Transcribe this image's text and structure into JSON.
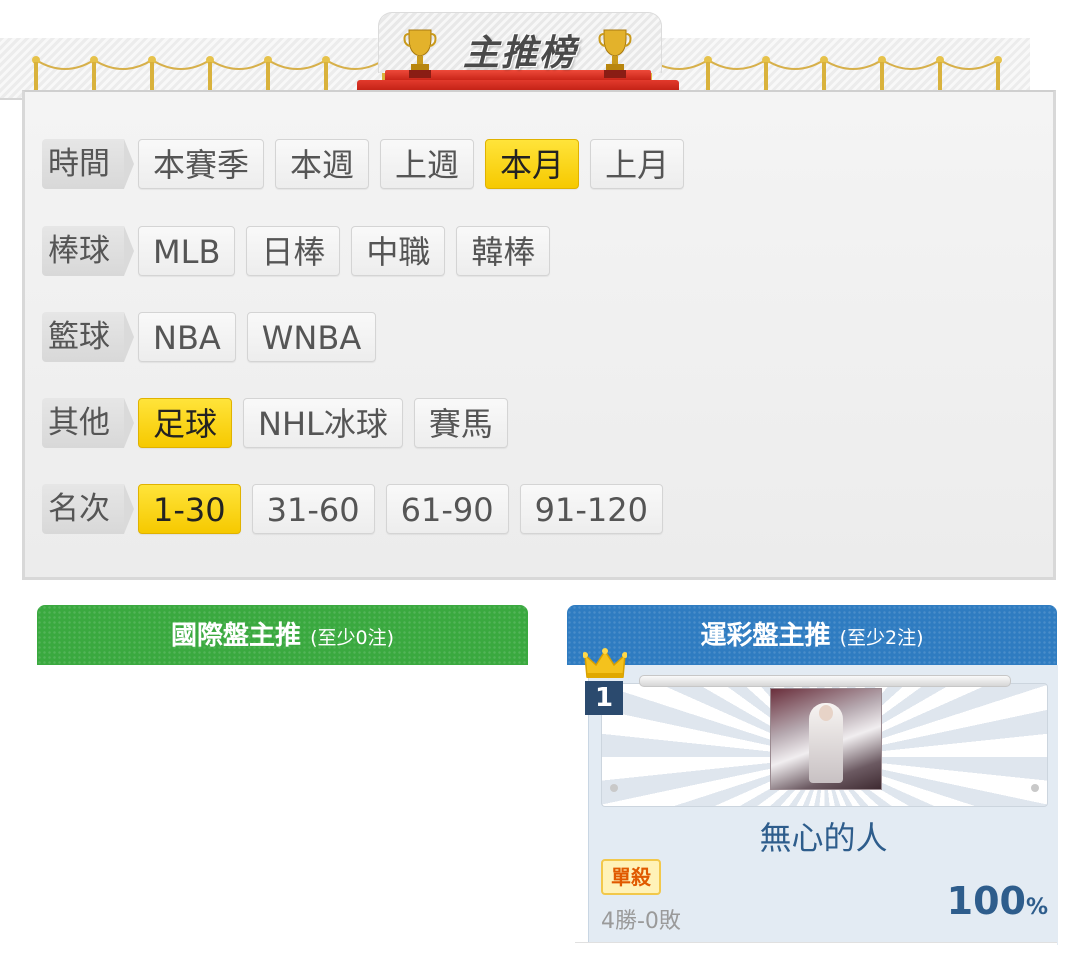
{
  "banner": {
    "title": "主推榜"
  },
  "filters": {
    "time": {
      "label": "時間",
      "options": [
        "本賽季",
        "本週",
        "上週",
        "本月",
        "上月"
      ],
      "selected": "本月"
    },
    "baseball": {
      "label": "棒球",
      "options": [
        "MLB",
        "日棒",
        "中職",
        "韓棒"
      ]
    },
    "basketball": {
      "label": "籃球",
      "options": [
        "NBA",
        "WNBA"
      ]
    },
    "other": {
      "label": "其他",
      "options": [
        "足球",
        "NHL冰球",
        "賽馬"
      ],
      "selected": "足球"
    },
    "rank": {
      "label": "名次",
      "options": [
        "1-30",
        "31-60",
        "61-90",
        "91-120"
      ],
      "selected": "1-30"
    }
  },
  "sections": {
    "international": {
      "title": "國際盤主推",
      "note": "(至少0注)"
    },
    "lottery": {
      "title": "運彩盤主推",
      "note": "(至少2注)"
    }
  },
  "ranking": {
    "rank": "1",
    "username": "無心的人",
    "tag": "單殺",
    "record": "4勝-0敗",
    "win_rate": "100",
    "win_rate_unit": "%"
  },
  "colors": {
    "active_chip": "#f6c900",
    "green_header": "#3aa93f",
    "blue_header": "#2f7cc1",
    "rank_badge": "#2b4a6e",
    "username": "#2e5d8c",
    "tag_text": "#e05a00"
  },
  "icons": [
    "trophy-icon",
    "crown-icon"
  ]
}
